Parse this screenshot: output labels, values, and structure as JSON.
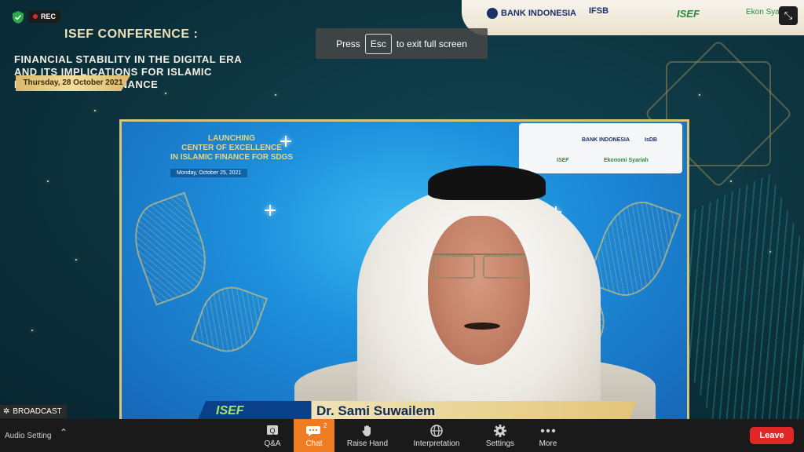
{
  "recording": {
    "label": "REC"
  },
  "conference": {
    "title_line1": "ISEF CONFERENCE :",
    "title_rest": "FINANCIAL STABILITY IN THE DIGITAL ERA\nAND ITS IMPLICATIONS FOR ISLAMIC\nECONOMICS AND FINANCE",
    "date": "Thursday, 28 October 2021"
  },
  "top_logos": {
    "bank_indonesia": "BANK INDONESIA",
    "ifsb": "IFSB",
    "isef": "ISEF",
    "ekonomi_syariah": "Ekon Syari"
  },
  "fullscreen_toast": {
    "press": "Press",
    "key": "Esc",
    "suffix": "to exit full screen"
  },
  "video": {
    "launch_title": "LAUNCHING\nCENTER OF EXCELLENCE\nIN ISLAMIC FINANCE FOR SDGs",
    "launch_date": "Monday, October 25, 2021",
    "partner_bank_indonesia": "BANK INDONESIA",
    "partner_isdb": "IsDB",
    "partner_isef": "ISEF",
    "partner_ekonomi_syariah": "Ekonomi Syariah",
    "name_bar": {
      "event": "ISEF",
      "speaker": "Dr. Sami Suwailem"
    }
  },
  "broadcast": {
    "label": "BROADCAST"
  },
  "toolbar": {
    "audio_setting": "Audio Setting",
    "items": [
      {
        "label": "Q&A",
        "icon": "qa-icon"
      },
      {
        "label": "Chat",
        "icon": "chat-icon",
        "badge": "2",
        "active": true
      },
      {
        "label": "Raise Hand",
        "icon": "raise-hand-icon"
      },
      {
        "label": "Interpretation",
        "icon": "globe-icon"
      },
      {
        "label": "Settings",
        "icon": "gear-icon"
      },
      {
        "label": "More",
        "icon": "more-icon"
      }
    ],
    "leave": "Leave"
  },
  "colors": {
    "accent_orange": "#f07c22",
    "leave_red": "#e02828",
    "rec_red": "#e02828"
  }
}
